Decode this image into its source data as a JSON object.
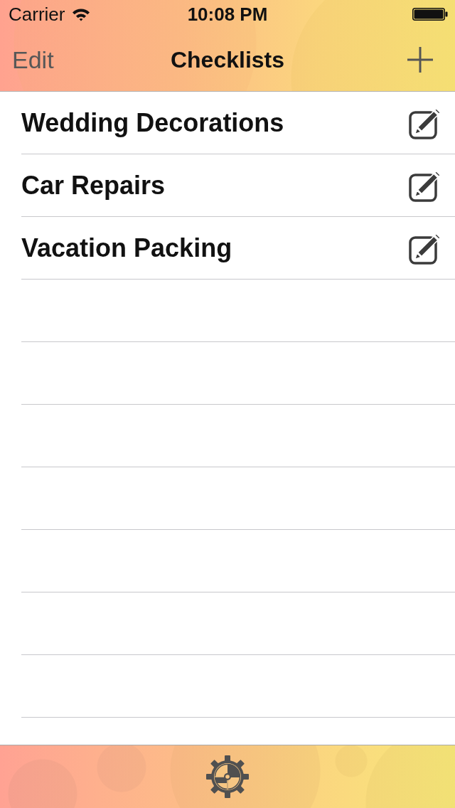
{
  "status_bar": {
    "carrier": "Carrier",
    "time": "10:08 PM"
  },
  "nav_bar": {
    "left_button": "Edit",
    "title": "Checklists"
  },
  "checklists": [
    {
      "name": "Wedding Decorations"
    },
    {
      "name": "Car Repairs"
    },
    {
      "name": "Vacation Packing"
    }
  ]
}
